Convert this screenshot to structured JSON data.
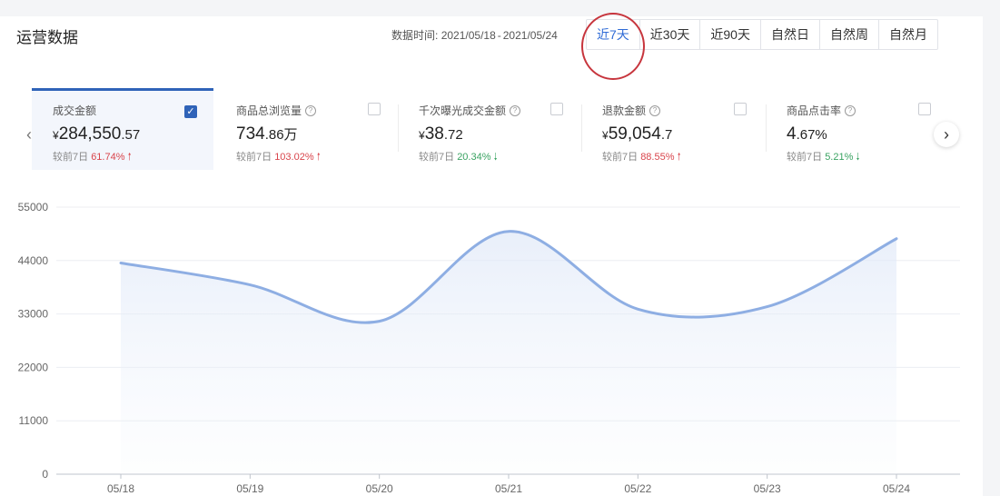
{
  "header": {
    "title": "运营数据",
    "date_label": "数据时间:",
    "date_start": "2021/05/18",
    "date_sep": "-",
    "date_end": "2021/05/24"
  },
  "range_tabs": [
    {
      "label": "近7天",
      "active": true
    },
    {
      "label": "近30天",
      "active": false
    },
    {
      "label": "近90天",
      "active": false
    },
    {
      "label": "自然日",
      "active": false
    },
    {
      "label": "自然周",
      "active": false
    },
    {
      "label": "自然月",
      "active": false
    }
  ],
  "metrics": [
    {
      "label": "成交金额",
      "help": false,
      "selected": true,
      "prefix": "¥",
      "main": "284,550",
      "sub": ".57",
      "compare_label": "较前7日",
      "compare_value": "61.74%",
      "trend": "up"
    },
    {
      "label": "商品总浏览量",
      "help": true,
      "selected": false,
      "prefix": "",
      "main": "734",
      "sub": ".86万",
      "compare_label": "较前7日",
      "compare_value": "103.02%",
      "trend": "up"
    },
    {
      "label": "千次曝光成交金额",
      "help": true,
      "selected": false,
      "prefix": "¥",
      "main": "38",
      "sub": ".72",
      "compare_label": "较前7日",
      "compare_value": "20.34%",
      "trend": "down"
    },
    {
      "label": "退款金额",
      "help": true,
      "selected": false,
      "prefix": "¥",
      "main": "59,054",
      "sub": ".7",
      "compare_label": "较前7日",
      "compare_value": "88.55%",
      "trend": "up"
    },
    {
      "label": "商品点击率",
      "help": true,
      "selected": false,
      "prefix": "",
      "main": "4",
      "sub": ".67%",
      "compare_label": "较前7日",
      "compare_value": "5.21%",
      "trend": "down"
    }
  ],
  "colors": {
    "accent": "#2f6bd6",
    "line": "#8eaee3",
    "up": "#d9454c",
    "down": "#3aa362",
    "highlight": "#c7353d"
  },
  "chart_data": {
    "type": "line",
    "title": "",
    "xlabel": "",
    "ylabel": "",
    "categories": [
      "05/18",
      "05/19",
      "05/20",
      "05/21",
      "05/22",
      "05/23",
      "05/24"
    ],
    "series": [
      {
        "values": [
          43500,
          39000,
          31500,
          50000,
          34000,
          34500,
          48500
        ]
      }
    ],
    "y_ticks": [
      0,
      11000,
      22000,
      33000,
      44000,
      55000
    ],
    "ylim": [
      0,
      55000
    ],
    "grid": true,
    "smooth": true,
    "area_fill": true
  }
}
